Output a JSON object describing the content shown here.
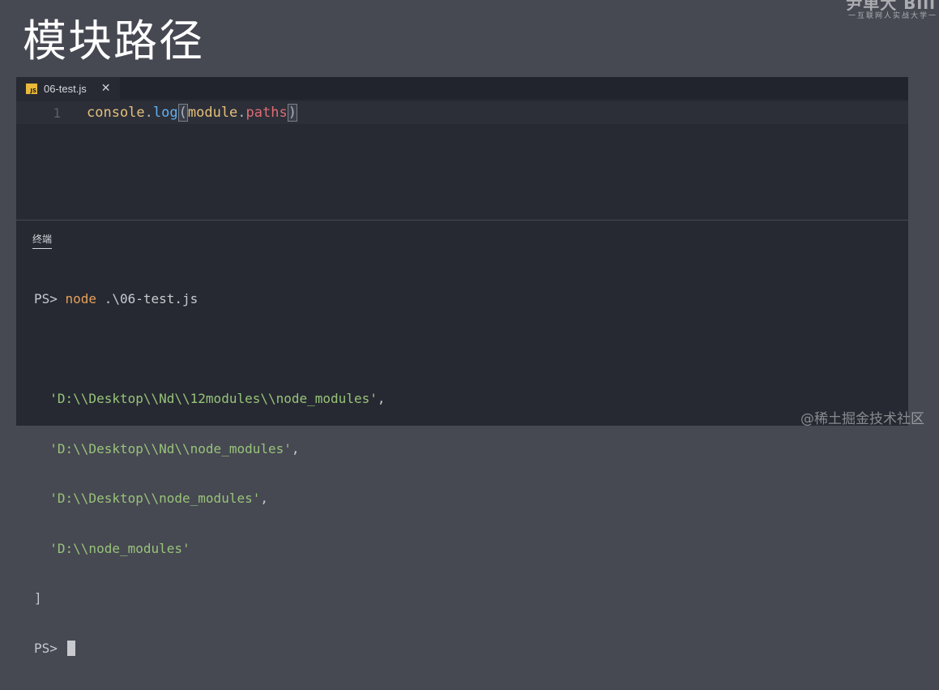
{
  "slide": {
    "title": "模块路径"
  },
  "brand": {
    "main": "尹单大 Bili",
    "sub": "一互联网人实战大学一"
  },
  "editor": {
    "tab": {
      "icon_text": "JS",
      "filename": "06-test.js",
      "close": "✕"
    },
    "lines": [
      {
        "number": "1",
        "tokens": {
          "obj": "console",
          "dot1": ".",
          "fn": "log",
          "open": "(",
          "mod": "module",
          "dot2": ".",
          "prop": "paths",
          "close": ")"
        }
      }
    ]
  },
  "terminal": {
    "tab_label": "终端",
    "prompt1": "PS> ",
    "command": "node",
    "command_arg": " .\\06-test.js",
    "output": [
      {
        "indent": "  ",
        "str": "'D:\\\\Desktop\\\\Nd\\\\12modules\\\\node_modules'",
        "tail": ","
      },
      {
        "indent": "  ",
        "str": "'D:\\\\Desktop\\\\Nd\\\\node_modules'",
        "tail": ","
      },
      {
        "indent": "  ",
        "str": "'D:\\\\Desktop\\\\node_modules'",
        "tail": ","
      },
      {
        "indent": "  ",
        "str": "'D:\\\\node_modules'",
        "tail": ""
      }
    ],
    "close_bracket": "]",
    "prompt2": "PS> "
  },
  "watermark": "@稀土掘金技术社区",
  "colors": {
    "background": "#464852",
    "editor_bg": "#272a33",
    "terminal_bg": "#262932",
    "string": "#98c379",
    "command": "#e5a05b",
    "function": "#61afef",
    "property": "#e06c75"
  }
}
